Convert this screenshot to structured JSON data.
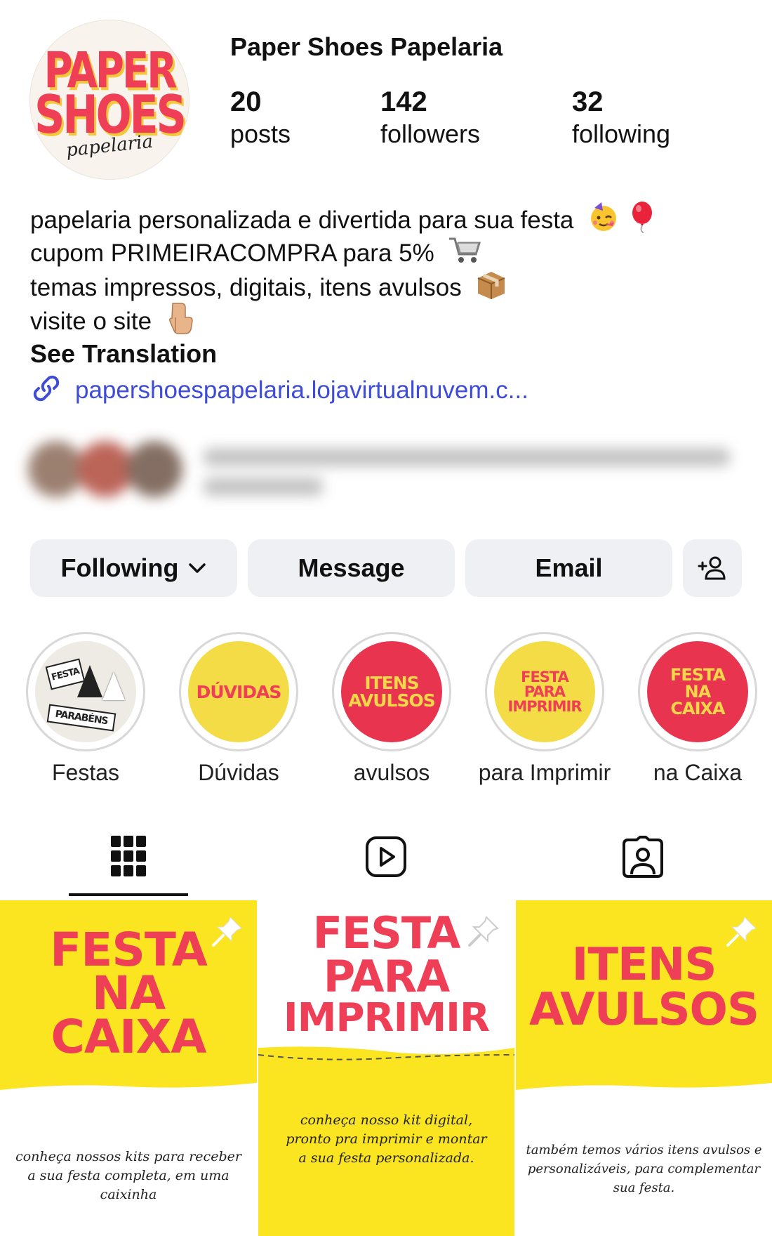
{
  "profile": {
    "name": "Paper Shoes Papelaria",
    "avatar": {
      "line1": "PAPER",
      "line2": "SHOES",
      "script": "papelaria"
    },
    "stats": [
      {
        "value": "20",
        "label": "posts"
      },
      {
        "value": "142",
        "label": "followers"
      },
      {
        "value": "32",
        "label": "following"
      }
    ]
  },
  "bio": {
    "lines": [
      "papelaria personalizada e divertida para sua festa",
      "cupom PRIMEIRACOMPRA para 5%",
      "temas impressos, digitais, itens avulsos",
      "visite o site"
    ],
    "emojis": [
      "partying-face-icon",
      "balloon-icon",
      "shopping-cart-icon",
      "package-icon",
      "pointing-down-icon"
    ],
    "see_translation": "See Translation",
    "link": "papershoespapelaria.lojavirtualnuvem.c..."
  },
  "actions": {
    "following": "Following",
    "message": "Message",
    "email": "Email"
  },
  "highlights": [
    {
      "label": "Festas",
      "art": [
        "FESTA",
        "PARABÉNS"
      ]
    },
    {
      "label": "Dúvidas",
      "art": [
        "DÚVIDAS"
      ]
    },
    {
      "label": "avulsos",
      "art": [
        "ITENS",
        "AVULSOS"
      ]
    },
    {
      "label": "para Imprimir",
      "art": [
        "FESTA",
        "PARA",
        "IMPRIMIR"
      ]
    },
    {
      "label": "na Caixa",
      "art": [
        "FESTA",
        "NA",
        "CAIXA"
      ]
    }
  ],
  "tabs": [
    "grid-icon",
    "reels-icon",
    "tagged-icon"
  ],
  "posts": [
    {
      "title": [
        "FESTA",
        "NA",
        "CAIXA"
      ],
      "desc": [
        "conheça nossos kits para receber",
        "a sua festa completa, em uma caixinha"
      ]
    },
    {
      "title": [
        "FESTA",
        "PARA",
        "IMPRIMIR"
      ],
      "desc": [
        "conheça nosso kit digital,",
        "pronto pra imprimir e montar",
        "a sua festa personalizada."
      ]
    },
    {
      "title": [
        "ITENS",
        "AVULSOS"
      ],
      "desc": [
        "também temos vários itens avulsos e",
        "personalizáveis, para complementar",
        "sua festa."
      ]
    }
  ],
  "colors": {
    "brand_red": "#ee3f57",
    "brand_yellow": "#fbe521",
    "link_blue": "#3e4cd8",
    "button_bg": "#eff0f4"
  }
}
